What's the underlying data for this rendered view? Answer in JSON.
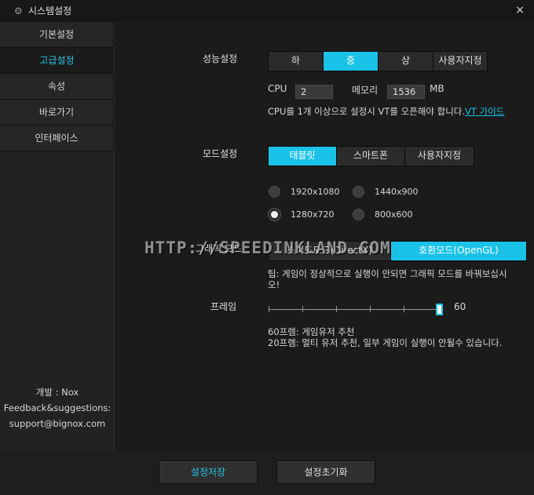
{
  "window": {
    "title": "시스템설정",
    "icon": "gear-icon",
    "close_label": "×"
  },
  "sidebar": {
    "items": [
      {
        "label": "기본설정",
        "active": false
      },
      {
        "label": "고급설정",
        "active": true
      },
      {
        "label": "속성",
        "active": false
      },
      {
        "label": "바로가기",
        "active": false
      },
      {
        "label": "인터페이스",
        "active": false
      }
    ],
    "footer": {
      "dev": "개발 : Nox",
      "feedback": "Feedback&suggestions:",
      "email": "support@bignox.com"
    }
  },
  "performance": {
    "label": "성능설정",
    "options": [
      "하",
      "중",
      "상",
      "사용자지정"
    ],
    "selected": "중",
    "cpu_label": "CPU",
    "cpu_value": "2",
    "memory_label": "메모리",
    "memory_value": "1536",
    "memory_unit": "MB",
    "note": "CPU를 1개 이상으로 설정시 VT를 오픈해야 합니다.",
    "note_link": "VT 가이드"
  },
  "mode": {
    "label": "모드설정",
    "options": [
      "태블릿",
      "스마트폰",
      "사용자지정"
    ],
    "selected": "태블릿",
    "resolutions": [
      {
        "label": "1920x1080",
        "selected": false
      },
      {
        "label": "1440x900",
        "selected": false
      },
      {
        "label": "1280x720",
        "selected": true
      },
      {
        "label": "800x600",
        "selected": false
      }
    ]
  },
  "graphics": {
    "label": "그래픽 모드",
    "options": [
      "스피드모드(DirectX)",
      "호환모드(OpenGL)"
    ],
    "selected": "호환모드(OpenGL)",
    "tip": "팁: 게임이 정상적으로 실행이 안되면 그래픽 모드를 바꿔보십시오!"
  },
  "frame": {
    "label": "프레임",
    "value": "60",
    "min": 10,
    "max": 60,
    "current": 60,
    "note1": "60프렘: 게임유저 추천",
    "note2": "20프렘: 멀티 유저 추천, 일부 게임이 실행이 안될수 있습니다."
  },
  "watermark": "HTTP://SPEEDINKLAND.COM",
  "buttons": {
    "save": "설정저장",
    "reset": "설정초기화"
  },
  "colors": {
    "accent": "#1bc2e8",
    "background": "#1b1b1b"
  }
}
